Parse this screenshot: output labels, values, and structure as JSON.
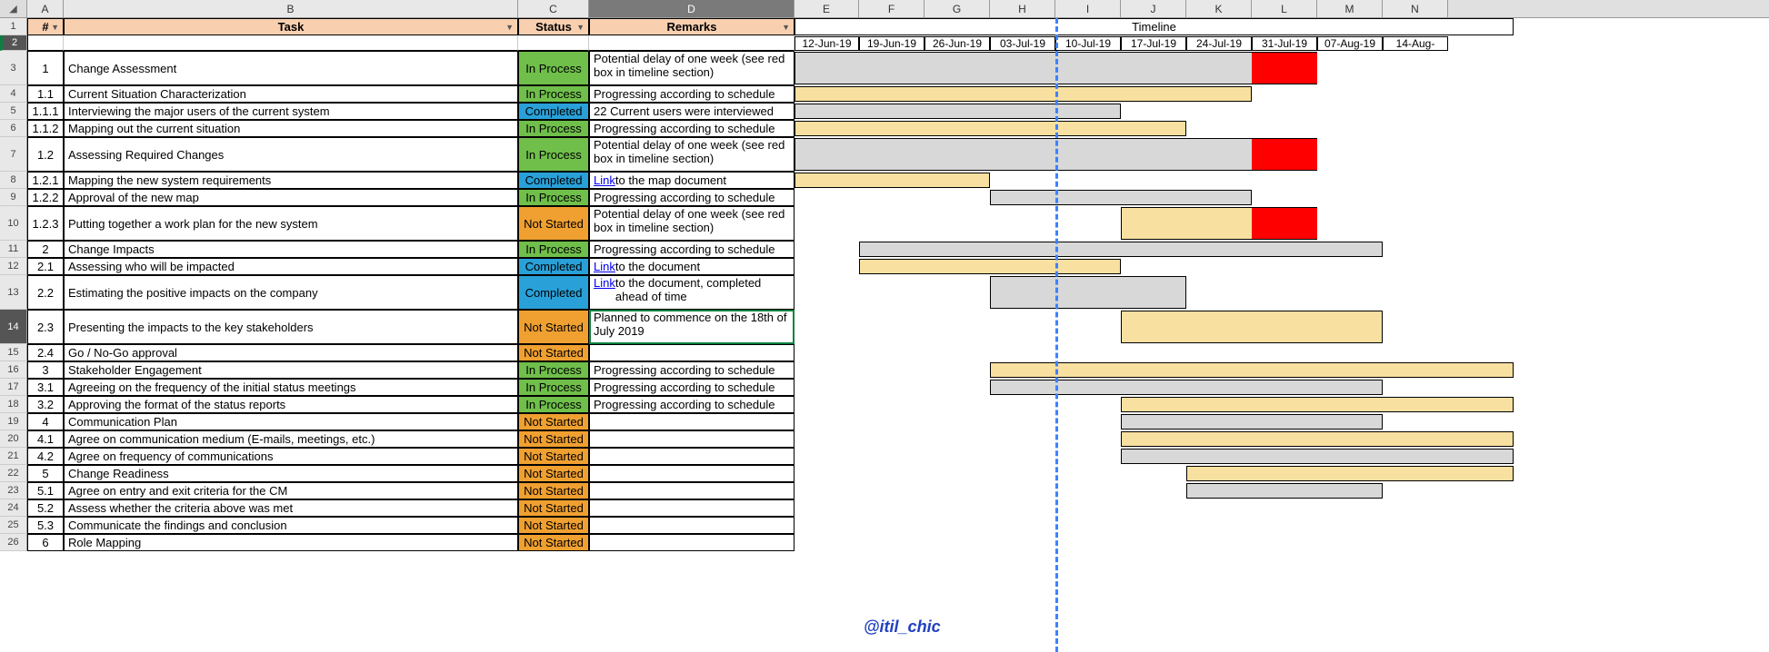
{
  "cols": [
    "A",
    "B",
    "C",
    "D",
    "E",
    "F",
    "G",
    "H",
    "I",
    "J",
    "K",
    "L",
    "M",
    "N"
  ],
  "header": {
    "num": "#",
    "task": "Task",
    "status": "Status",
    "remarks": "Remarks",
    "timeline": "Timeline"
  },
  "dates": [
    "12-Jun-19",
    "19-Jun-19",
    "26-Jun-19",
    "03-Jul-19",
    "10-Jul-19",
    "17-Jul-19",
    "24-Jul-19",
    "31-Jul-19",
    "07-Aug-19",
    "14-Aug-"
  ],
  "status_labels": {
    "inprocess": "In Process",
    "completed": "Completed",
    "notstarted": "Not Started"
  },
  "rows": [
    {
      "r": 3,
      "tall": true,
      "num": "1",
      "task": "Change Assessment",
      "status": "inprocess",
      "remarks": "Potential delay of one week (see red box in timeline section)",
      "bar": {
        "type": "sum",
        "s": 0,
        "e": 7,
        "red": 7
      }
    },
    {
      "r": 4,
      "num": "1.1",
      "task": "Current Situation Characterization",
      "status": "inprocess",
      "remarks": "Progressing according to schedule",
      "bar": {
        "type": "task",
        "s": 0,
        "e": 6
      }
    },
    {
      "r": 5,
      "num": "1.1.1",
      "task": "Interviewing the major users of the current system",
      "status": "completed",
      "remarks": "22 Current users were interviewed",
      "bar": {
        "type": "sum",
        "s": 0,
        "e": 4
      }
    },
    {
      "r": 6,
      "num": "1.1.2",
      "task": "Mapping out the current situation",
      "status": "inprocess",
      "remarks": "Progressing according to schedule",
      "bar": {
        "type": "task",
        "s": 0,
        "e": 5
      }
    },
    {
      "r": 7,
      "tall": true,
      "num": "1.2",
      "task": "Assessing Required Changes",
      "status": "inprocess",
      "remarks": "Potential delay of one week (see red box in timeline section)",
      "bar": {
        "type": "sum",
        "s": 0,
        "e": 7,
        "red": 7
      }
    },
    {
      "r": 8,
      "num": "1.2.1",
      "task": "Mapping the new system requirements",
      "status": "completed",
      "remarkslink": "Link",
      "remarksafter": " to the map document",
      "bar": {
        "type": "task",
        "s": 0,
        "e": 2
      }
    },
    {
      "r": 9,
      "num": "1.2.2",
      "task": "Approval of the new map",
      "status": "inprocess",
      "remarks": "Progressing according to schedule",
      "bar": {
        "type": "sum",
        "s": 3,
        "e": 6
      }
    },
    {
      "r": 10,
      "tall": true,
      "num": "1.2.3",
      "task": "Putting together a work plan for the new system",
      "status": "notstarted",
      "remarks": "Potential delay of one week (see red box in timeline section)",
      "bar": {
        "type": "task",
        "s": 5,
        "e": 7,
        "red": 7
      }
    },
    {
      "r": 11,
      "num": "2",
      "task": "Change Impacts",
      "status": "inprocess",
      "remarks": "Progressing according to schedule",
      "bar": {
        "type": "sum",
        "s": 1,
        "e": 8
      }
    },
    {
      "r": 12,
      "num": "2.1",
      "task": "Assessing who will be impacted",
      "status": "completed",
      "remarkslink": "Link",
      "remarksafter": " to the document",
      "bar": {
        "type": "task",
        "s": 1,
        "e": 4
      }
    },
    {
      "r": 13,
      "tall": true,
      "num": "2.2",
      "task": "Estimating the positive impacts on the company",
      "status": "completed",
      "remarkslink": "Link",
      "remarksafter": " to the document, completed ahead of time",
      "bar": {
        "type": "sum",
        "s": 3,
        "e": 5
      }
    },
    {
      "r": 14,
      "tall": true,
      "num": "2.3",
      "task": "Presenting the impacts to the key stakeholders",
      "status": "notstarted",
      "remarks": "Planned to commence on the 18th of July 2019",
      "bar": {
        "type": "task",
        "s": 5,
        "e": 8
      }
    },
    {
      "r": 15,
      "num": "2.4",
      "task": "Go / No-Go approval",
      "status": "notstarted",
      "remarks": ""
    },
    {
      "r": 16,
      "num": "3",
      "task": "Stakeholder Engagement",
      "status": "inprocess",
      "remarks": "Progressing according to schedule",
      "bar": {
        "type": "task",
        "s": 3,
        "e": 10
      }
    },
    {
      "r": 17,
      "num": "3.1",
      "task": "Agreeing on the frequency of the initial status meetings",
      "status": "inprocess",
      "remarks": "Progressing according to schedule",
      "bar": {
        "type": "sum",
        "s": 3,
        "e": 8
      }
    },
    {
      "r": 18,
      "num": "3.2",
      "task": "Approving the format of the status reports",
      "status": "inprocess",
      "remarks": "Progressing according to schedule",
      "bar": {
        "type": "task",
        "s": 5,
        "e": 10
      }
    },
    {
      "r": 19,
      "num": "4",
      "task": "Communication Plan",
      "status": "notstarted",
      "remarks": "",
      "bar": {
        "type": "sum",
        "s": 5,
        "e": 8
      }
    },
    {
      "r": 20,
      "num": "4.1",
      "task": "Agree on communication medium (E-mails, meetings, etc.)",
      "status": "notstarted",
      "remarks": "",
      "bar": {
        "type": "task",
        "s": 5,
        "e": 10
      }
    },
    {
      "r": 21,
      "num": "4.2",
      "task": "Agree on frequency of communications",
      "status": "notstarted",
      "remarks": "",
      "bar": {
        "type": "sum",
        "s": 5,
        "e": 10
      }
    },
    {
      "r": 22,
      "num": "5",
      "task": "Change Readiness",
      "status": "notstarted",
      "remarks": "",
      "bar": {
        "type": "task",
        "s": 6,
        "e": 10
      }
    },
    {
      "r": 23,
      "num": "5.1",
      "task": "Agree on entry and exit criteria for the CM",
      "status": "notstarted",
      "remarks": "",
      "bar": {
        "type": "sum",
        "s": 6,
        "e": 8
      }
    },
    {
      "r": 24,
      "num": "5.2",
      "task": "Assess whether the criteria above was met",
      "status": "notstarted",
      "remarks": ""
    },
    {
      "r": 25,
      "num": "5.3",
      "task": "Communicate the findings and conclusion",
      "status": "notstarted",
      "remarks": ""
    },
    {
      "r": 26,
      "num": "6",
      "task": "Role Mapping",
      "status": "notstarted",
      "remarks": ""
    }
  ],
  "watermark": "@itil_chic",
  "todayCol": 4
}
